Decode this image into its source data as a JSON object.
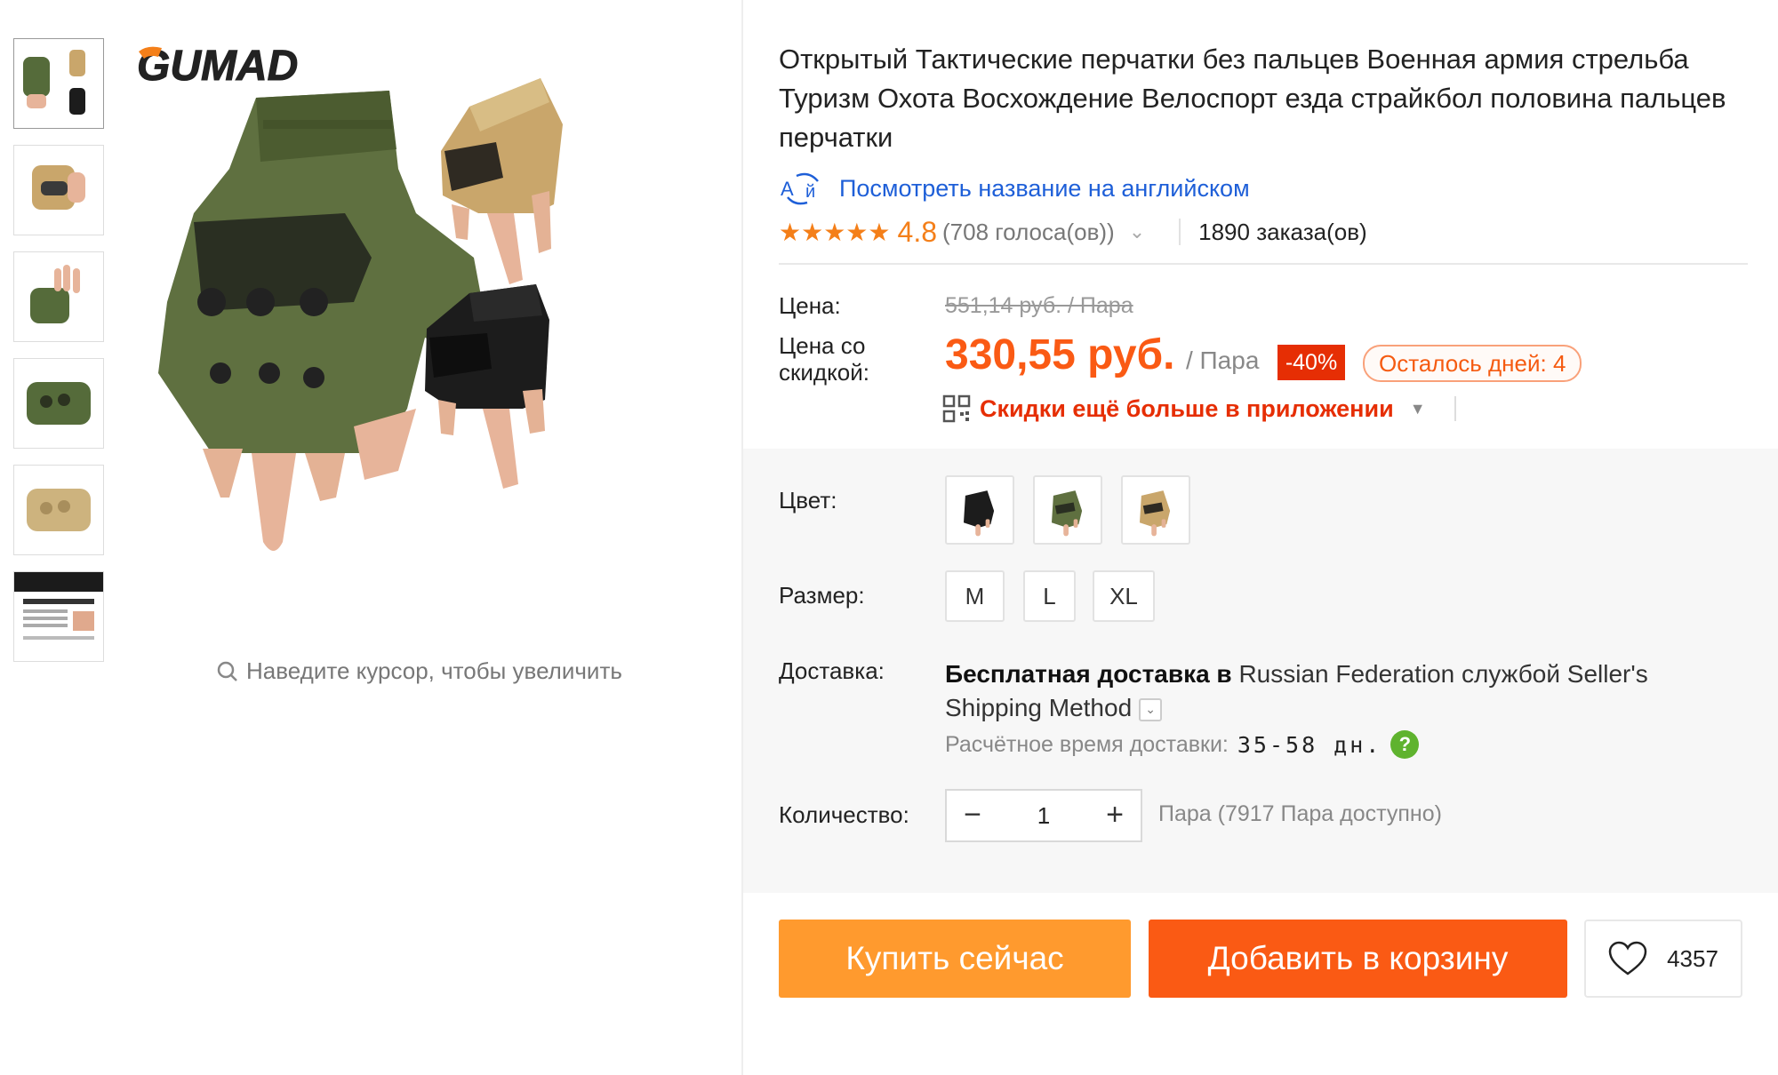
{
  "gallery": {
    "brand_logo": "GUMAD",
    "zoom_hint": "Наведите курсор, чтобы увеличить",
    "thumbs": [
      "thumb-green-set",
      "thumb-tan-hand",
      "thumb-green-hand",
      "thumb-green-flat",
      "thumb-tan-flat",
      "thumb-size-chart"
    ]
  },
  "product": {
    "title": "Открытый Тактические перчатки без пальцев Военная армия стрельба Туризм Охота Восхождение Велоспорт езда страйкбол половина пальцев перчатки",
    "translate_link": "Посмотреть название на английском",
    "stars": "★★★★★",
    "rating": "4.8",
    "votes": "(708 голоса(ов))",
    "orders": "1890 заказа(ов)"
  },
  "price": {
    "label": "Цена:",
    "old": "551,14 руб. / Пара",
    "discount_label_1": "Цена со",
    "discount_label_2": "скидкой:",
    "new": "330,55 руб.",
    "unit": "/ Пара",
    "discount": "-40%",
    "days_left": "Осталось дней: 4",
    "app_promo": "Скидки ещё больше в приложении"
  },
  "options": {
    "color_label": "Цвет:",
    "colors": [
      "black",
      "green",
      "tan"
    ],
    "size_label": "Размер:",
    "sizes": [
      "M",
      "L",
      "XL"
    ]
  },
  "shipping": {
    "label": "Доставка:",
    "free": "Бесплатная доставка в",
    "destination": "Russian Federation",
    "via": "службой",
    "method": "Seller's Shipping Method",
    "eta_label": "Расчётное время доставки:",
    "eta_value": "35-58 дн."
  },
  "quantity": {
    "label": "Количество:",
    "value": "1",
    "available": "Пара (7917 Пара доступно)"
  },
  "actions": {
    "buy_now": "Купить сейчас",
    "add_to_cart": "Добавить в корзину",
    "wishlist_count": "4357"
  },
  "colors": {
    "accent_orange": "#fa5a14",
    "buy_orange": "#ff9a2e",
    "discount_red": "#e62e04",
    "link_blue": "#1e5fd8",
    "star_orange": "#f47f19"
  }
}
